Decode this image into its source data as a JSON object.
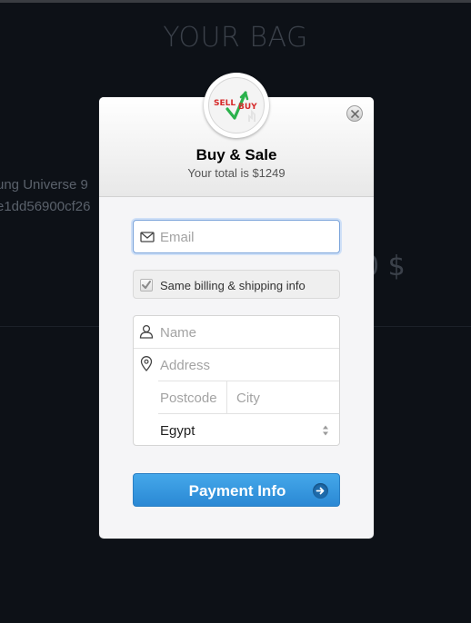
{
  "background": {
    "page_title": "YOUR BAG",
    "product_name": "ung Universe 9",
    "product_id": "e1dd56900cf26",
    "price_fragment": "0 $"
  },
  "modal": {
    "logo": {
      "sell_text": "SELL",
      "buy_text": "BUY"
    },
    "title": "Buy & Sale",
    "subtitle": "Your total is $1249",
    "close_icon": "close-icon"
  },
  "form": {
    "email": {
      "placeholder": "Email",
      "value": "",
      "icon": "envelope-icon"
    },
    "same_billing": {
      "label": "Same billing & shipping info",
      "checked": true
    },
    "name": {
      "placeholder": "Name",
      "value": "",
      "icon": "user-icon"
    },
    "address": {
      "placeholder": "Address",
      "value": "",
      "icon": "location-pin-icon"
    },
    "postcode": {
      "placeholder": "Postcode",
      "value": ""
    },
    "city": {
      "placeholder": "City",
      "value": ""
    },
    "country": {
      "selected": "Egypt"
    }
  },
  "actions": {
    "pay_label": "Payment Info",
    "pay_icon": "arrow-right-icon"
  },
  "colors": {
    "page_bg": "#0d1117",
    "accent": "#2a88d4",
    "focus_border": "#7aa3da",
    "modal_bg": "#f5f5f7"
  }
}
